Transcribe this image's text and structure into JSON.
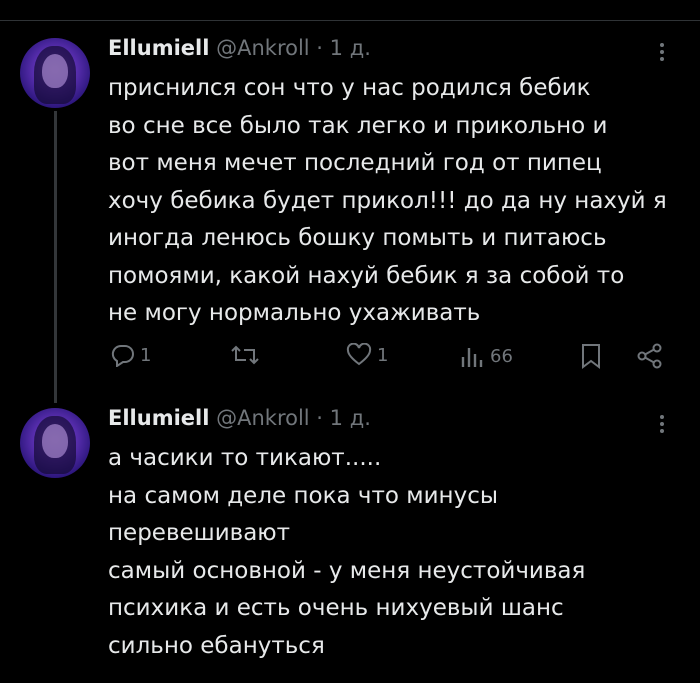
{
  "tweets": [
    {
      "display_name": "Ellumiell",
      "meta": "@Ankroll · 1 д.",
      "lines": [
        "приснился сон что у нас родился бебик",
        "во сне все было так легко и прикольно и",
        "вот меня мечет последний год от пипец",
        "хочу бебика будет прикол!!! до да ну нахуй я",
        "иногда ленюсь бошку помыть и питаюсь",
        "помоями, какой нахуй бебик я за собой то",
        "не могу нормально ухаживать"
      ],
      "actions": {
        "replies": "1",
        "retweets": "",
        "likes": "1",
        "views": "66"
      }
    },
    {
      "display_name": "Ellumiell",
      "meta": "@Ankroll · 1 д.",
      "lines": [
        "а часики то тикают.....",
        "на самом деле пока что минусы",
        "перевешивают",
        "самый основной - у меня неустойчивая",
        "психика и есть очень нихуевый шанс",
        "сильно ебануться"
      ]
    }
  ],
  "colors": {
    "background": "#000000",
    "text": "#e7e9ea",
    "secondary": "#71767b",
    "avatar_accent": "#5a2fb0"
  },
  "icons": [
    "reply-icon",
    "retweet-icon",
    "like-icon",
    "views-icon",
    "bookmark-icon",
    "share-icon",
    "more-icon"
  ]
}
